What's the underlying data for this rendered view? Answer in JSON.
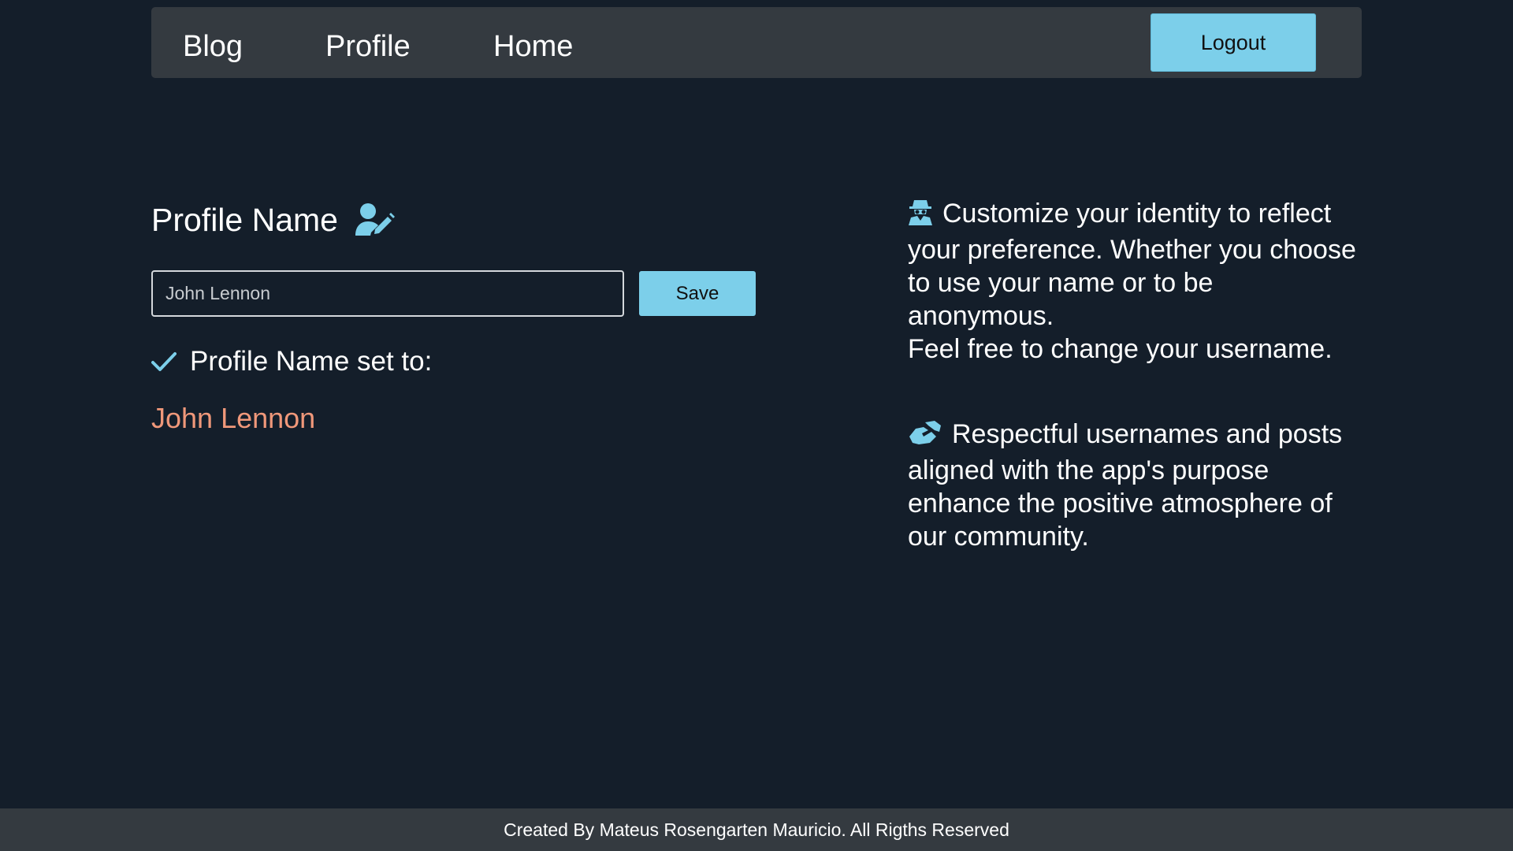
{
  "nav": {
    "links": [
      {
        "label": "Blog"
      },
      {
        "label": "Profile"
      },
      {
        "label": "Home"
      }
    ],
    "logout_label": "Logout"
  },
  "profile": {
    "title": "Profile Name",
    "title_icon": "user-pen-icon",
    "input_value": "John Lennon",
    "save_label": "Save",
    "status_icon": "check-icon",
    "status_text": "Profile Name set to:",
    "current_name": "John Lennon"
  },
  "info": {
    "block1": {
      "icon": "user-secret-icon",
      "line1": "Customize your identity to reflect your preference. Whether you choose to use your name or to be anonymous.",
      "line2": "Feel free to change your username."
    },
    "block2": {
      "icon": "handshake-icon",
      "text": "Respectful usernames and posts aligned with the app's purpose enhance the positive atmosphere of our community."
    }
  },
  "footer": {
    "text": "Created By Mateus Rosengarten Mauricio. All Rigths Reserved"
  },
  "colors": {
    "background": "#141e2a",
    "navbar": "#343a40",
    "accent": "#7ccfea",
    "name_highlight": "#f0987a"
  }
}
